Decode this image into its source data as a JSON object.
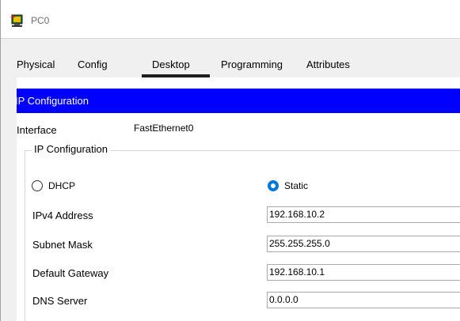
{
  "window": {
    "title": "PC0",
    "icon": "computer-icon"
  },
  "tabs": [
    {
      "label": "Physical",
      "active": false
    },
    {
      "label": "Config",
      "active": false
    },
    {
      "label": "Desktop",
      "active": true
    },
    {
      "label": "Programming",
      "active": false
    },
    {
      "label": "Attributes",
      "active": false
    }
  ],
  "ip_config": {
    "header": "IP Configuration",
    "interface_label": "Interface",
    "interface_value": "FastEthernet0",
    "group_label": "IP Configuration",
    "dhcp_label": "DHCP",
    "static_label": "Static",
    "selected_mode": "Static",
    "fields": [
      {
        "label": "IPv4 Address",
        "value": "192.168.10.2"
      },
      {
        "label": "Subnet Mask",
        "value": "255.255.255.0"
      },
      {
        "label": "Default Gateway",
        "value": "192.168.10.1"
      },
      {
        "label": "DNS Server",
        "value": "0.0.0.0"
      }
    ]
  },
  "colors": {
    "header_bar": "#0000ff",
    "radio_selected": "#0078d7"
  }
}
